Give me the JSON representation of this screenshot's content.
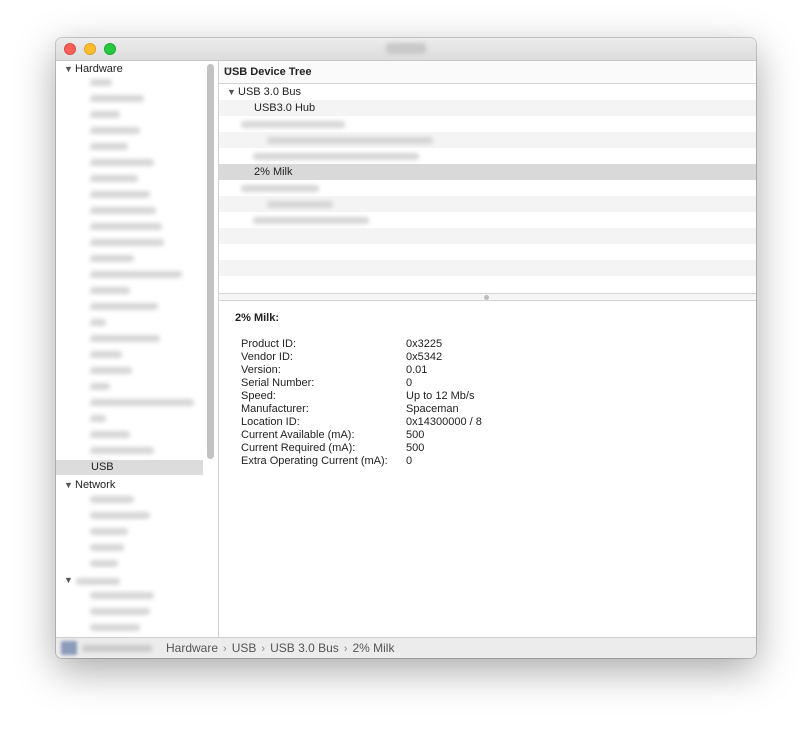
{
  "window": {
    "title": ""
  },
  "sidebar": {
    "groups": [
      {
        "label": "Hardware",
        "expanded": true
      },
      {
        "label": "Network",
        "expanded": true
      },
      {
        "label": "",
        "expanded": true
      }
    ],
    "selected_item": "USB"
  },
  "tree": {
    "header": "USB Device Tree",
    "rows": [
      {
        "label": "USB 3.0 Bus",
        "expanded": true
      },
      {
        "label": "USB3.0 Hub"
      },
      {
        "label": "2% Milk",
        "selected": true
      }
    ]
  },
  "detail": {
    "title": "2% Milk:",
    "properties": [
      {
        "label": "Product ID:",
        "value": "0x3225"
      },
      {
        "label": "Vendor ID:",
        "value": "0x5342"
      },
      {
        "label": "Version:",
        "value": "0.01"
      },
      {
        "label": "Serial Number:",
        "value": "0"
      },
      {
        "label": "Speed:",
        "value": "Up to 12 Mb/s"
      },
      {
        "label": "Manufacturer:",
        "value": "Spaceman"
      },
      {
        "label": "Location ID:",
        "value": "0x14300000 / 8"
      },
      {
        "label": "Current Available (mA):",
        "value": "500"
      },
      {
        "label": "Current Required (mA):",
        "value": "500"
      },
      {
        "label": "Extra Operating Current (mA):",
        "value": "0"
      }
    ]
  },
  "breadcrumb": [
    "Hardware",
    "USB",
    "USB 3.0 Bus",
    "2% Milk"
  ],
  "colors": {
    "selection": "#dcdcdc",
    "close": "#fc5f57",
    "minimize": "#fdbc2e",
    "zoom": "#28c840"
  }
}
